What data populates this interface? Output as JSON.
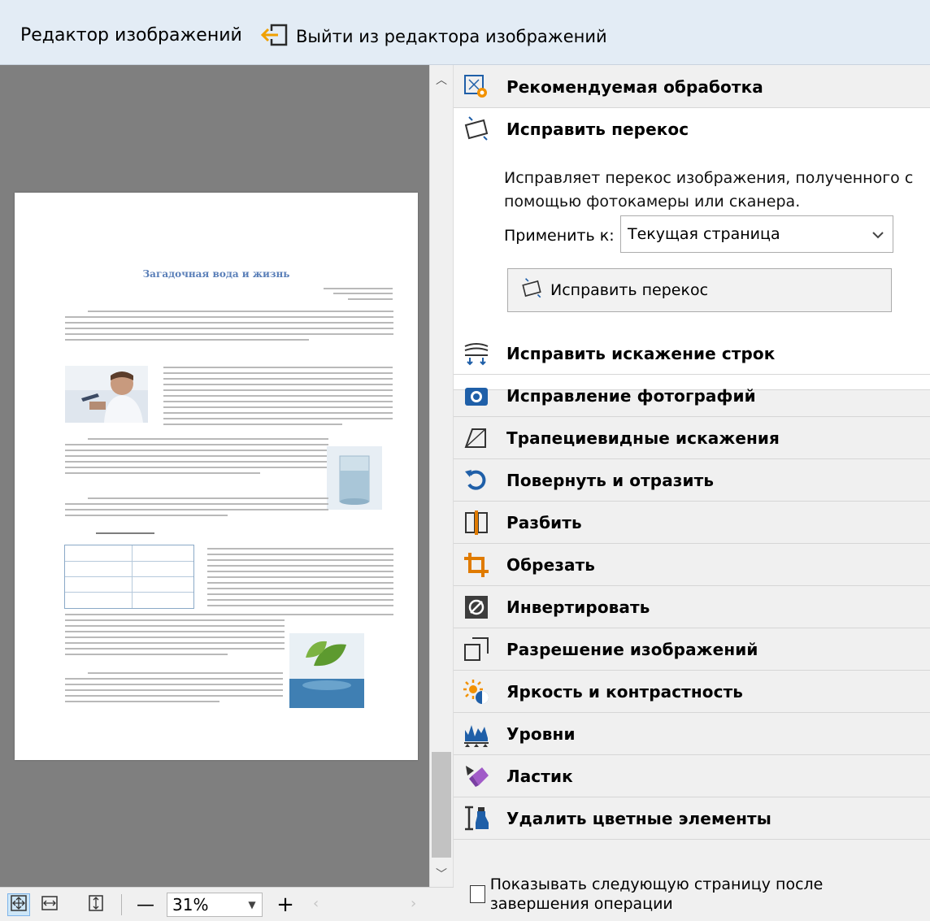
{
  "header": {
    "title": "Редактор изображений",
    "exit_label": "Выйти из редактора изображений"
  },
  "document_preview": {
    "page_title": "Загадочная вода и жизнь"
  },
  "bottom_toolbar": {
    "zoom_value": "31%",
    "zoom_minus": "—",
    "zoom_plus": "+"
  },
  "tools": [
    {
      "label": "Рекомендуемая обработка",
      "icon": "auto-process-icon",
      "color": "#1f5fa8"
    },
    {
      "label": "Исправить перекос",
      "icon": "deskew-icon",
      "color": "#1f5fa8"
    },
    {
      "label": "Исправить искажение строк",
      "icon": "straighten-lines-icon",
      "color": "#1f5fa8"
    },
    {
      "label": "Исправление фотографий",
      "icon": "camera-icon",
      "color": "#1f5fa8"
    },
    {
      "label": "Трапециевидные искажения",
      "icon": "trapezoid-icon",
      "color": "#333333"
    },
    {
      "label": "Повернуть и отразить",
      "icon": "rotate-icon",
      "color": "#1f5fa8"
    },
    {
      "label": "Разбить",
      "icon": "split-icon",
      "color": "#e07b00"
    },
    {
      "label": "Обрезать",
      "icon": "crop-icon",
      "color": "#e07b00"
    },
    {
      "label": "Инвертировать",
      "icon": "invert-icon",
      "color": "#333333"
    },
    {
      "label": "Разрешение изображений",
      "icon": "resolution-icon",
      "color": "#333333"
    },
    {
      "label": "Яркость и контрастность",
      "icon": "brightness-icon",
      "color": "#e07b00"
    },
    {
      "label": "Уровни",
      "icon": "levels-icon",
      "color": "#1f5fa8"
    },
    {
      "label": "Ластик",
      "icon": "eraser-icon",
      "color": "#8a4fb0"
    },
    {
      "label": "Удалить цветные элементы",
      "icon": "remove-color-icon",
      "color": "#1f5fa8"
    }
  ],
  "deskew_panel": {
    "description": "Исправляет перекос изображения, полученного с помощью фотокамеры или сканера.",
    "apply_label": "Применить к:",
    "apply_value": "Текущая страница",
    "button_label": "Исправить перекос"
  },
  "footer_option": {
    "label": "Показывать следующую страницу после завершения операции",
    "checked": false
  }
}
